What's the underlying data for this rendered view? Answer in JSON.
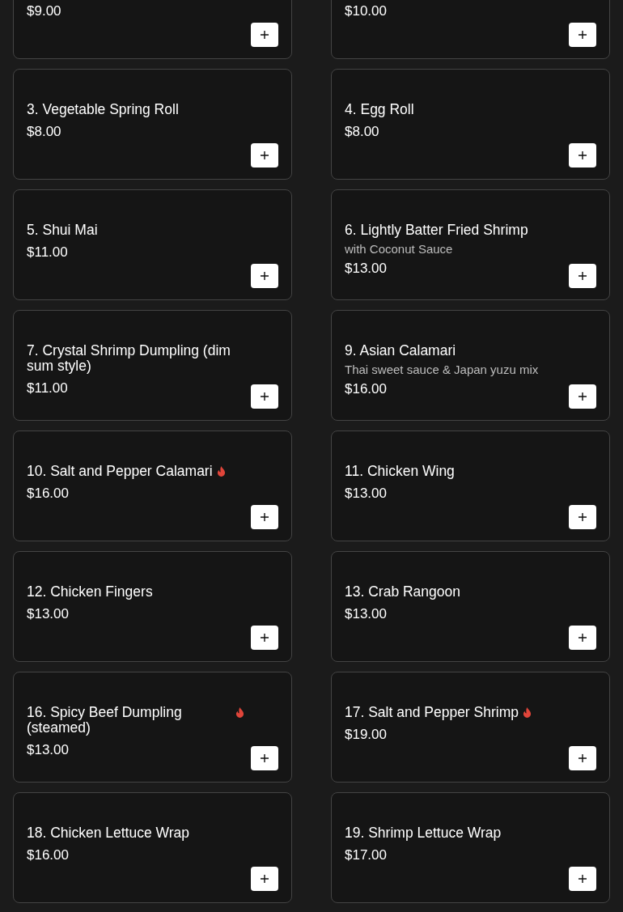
{
  "menu_items": [
    {
      "price": "$9.00"
    },
    {
      "price": "$10.00"
    },
    {
      "name": "3. Vegetable Spring Roll",
      "price": "$8.00",
      "spicy": false
    },
    {
      "name": "4. Egg Roll",
      "price": "$8.00",
      "spicy": false
    },
    {
      "name": "5. Shui Mai",
      "price": "$11.00",
      "spicy": false
    },
    {
      "name": "6. Lightly Batter Fried Shrimp",
      "description": "with Coconut Sauce",
      "price": "$13.00",
      "spicy": false
    },
    {
      "name": "7. Crystal Shrimp Dumpling (dim sum style)",
      "price": "$11.00",
      "spicy": false
    },
    {
      "name": "9. Asian Calamari",
      "description": "Thai sweet sauce & Japan yuzu mix",
      "price": "$16.00",
      "spicy": false
    },
    {
      "name": "10. Salt and Pepper Calamari",
      "price": "$16.00",
      "spicy": true
    },
    {
      "name": "11. Chicken Wing",
      "price": "$13.00",
      "spicy": false
    },
    {
      "name": "12. Chicken Fingers",
      "price": "$13.00",
      "spicy": false
    },
    {
      "name": "13. Crab Rangoon",
      "price": "$13.00",
      "spicy": false
    },
    {
      "name": "16. Spicy Beef Dumpling (steamed)",
      "price": "$13.00",
      "spicy": true
    },
    {
      "name": "17. Salt and Pepper Shrimp",
      "price": "$19.00",
      "spicy": true
    },
    {
      "name": "18. Chicken Lettuce Wrap",
      "price": "$16.00",
      "spicy": false
    },
    {
      "name": "19. Shrimp Lettuce Wrap",
      "price": "$17.00",
      "spicy": false
    }
  ]
}
